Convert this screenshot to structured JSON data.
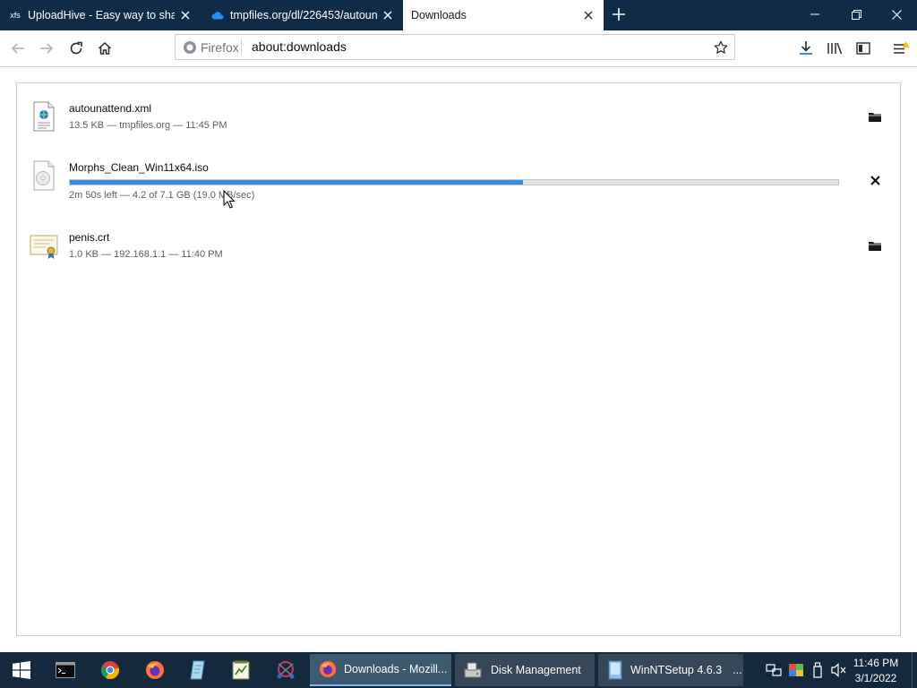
{
  "tabs": [
    {
      "title": "UploadHive - Easy way to share",
      "favicon": "xfs",
      "active": false
    },
    {
      "title": "tmpfiles.org/dl/226453/autoun",
      "favicon": "cloud-icon",
      "active": false
    },
    {
      "title": "Downloads",
      "favicon": "",
      "active": true
    }
  ],
  "navbar": {
    "identity_label": "Firefox",
    "url": "about:downloads"
  },
  "downloads": [
    {
      "name": "autounattend.xml",
      "status": "13.5 KB — tmpfiles.org — 11:45 PM",
      "icon": "xml-file-icon",
      "action": "folder-icon"
    },
    {
      "name": "Morphs_Clean_Win11x64.iso",
      "status": "2m 50s left — 4.2 of 7.1 GB (19.0 MB/sec)",
      "icon": "disc-image-icon",
      "action": "cancel-icon",
      "progress": 0.59
    },
    {
      "name": "penis.crt",
      "status": "1.0 KB — 192.168.1.1 — 11:40 PM",
      "icon": "certificate-icon",
      "action": "folder-icon"
    }
  ],
  "taskbar": {
    "tasks": [
      {
        "label": "Downloads - Mozill...",
        "icon": "firefox-icon",
        "active": true
      },
      {
        "label": "Disk Management",
        "icon": "disk-management-icon",
        "active": false
      },
      {
        "label": "WinNTSetup 4.6.3",
        "icon": "winntsetup-icon",
        "active": false,
        "more": "..."
      }
    ],
    "time": "11:46 PM",
    "date": "3/1/2022"
  },
  "colors": {
    "tabstrip": "#0f2b47",
    "taskbar": "#14283e",
    "progress_fill": "#3d8bdf",
    "progress_track": "#e3e3e6"
  }
}
